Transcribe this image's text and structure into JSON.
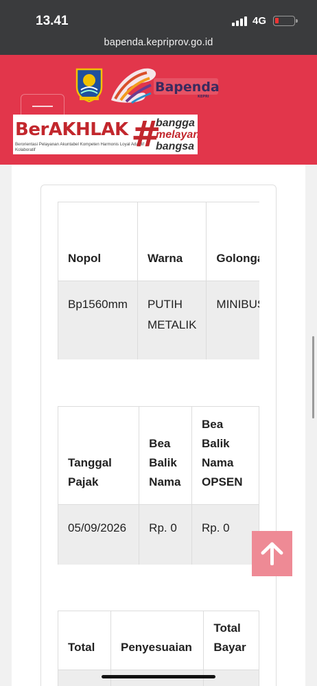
{
  "status_bar": {
    "time": "13.41",
    "network": "4G",
    "battery_icon": "battery-low-icon",
    "signal_icon": "cellular-signal-icon"
  },
  "browser": {
    "url": "bapenda.kepriprov.go.id"
  },
  "header": {
    "brand_name": "Bapenda",
    "brand_sub": "KEPRI",
    "banner": {
      "word": "BerAKHLAK",
      "tagline": "Berorientasi Pelayanan Akuntabel Kompeten Harmonis Loyal Adaptif Kolaboratif",
      "hash": "#",
      "motto_line1": "bangga",
      "motto_line2": "melayani",
      "motto_line3": "bangsa"
    },
    "menu_icon": "hamburger-menu-icon",
    "colors": {
      "header_bg": "#e2364b",
      "brand_red": "#c2272d"
    }
  },
  "table1": {
    "headers": [
      "Nopol",
      "Warna",
      "Golongan"
    ],
    "rows": [
      [
        "Bp1560mm",
        "PUTIH METALIK",
        "MINIBUS"
      ]
    ]
  },
  "table2": {
    "headers": [
      "Tanggal Pajak",
      "Bea Balik Nama",
      "Bea Balik Nama OPSEN"
    ],
    "rows": [
      [
        "05/09/2026",
        "Rp. 0",
        "Rp. 0"
      ]
    ]
  },
  "table3": {
    "headers": [
      "Total",
      "Penyesuaian",
      "Total Bayar"
    ]
  },
  "scroll_top": {
    "icon": "arrow-up-icon",
    "color": "#ee8a95"
  }
}
